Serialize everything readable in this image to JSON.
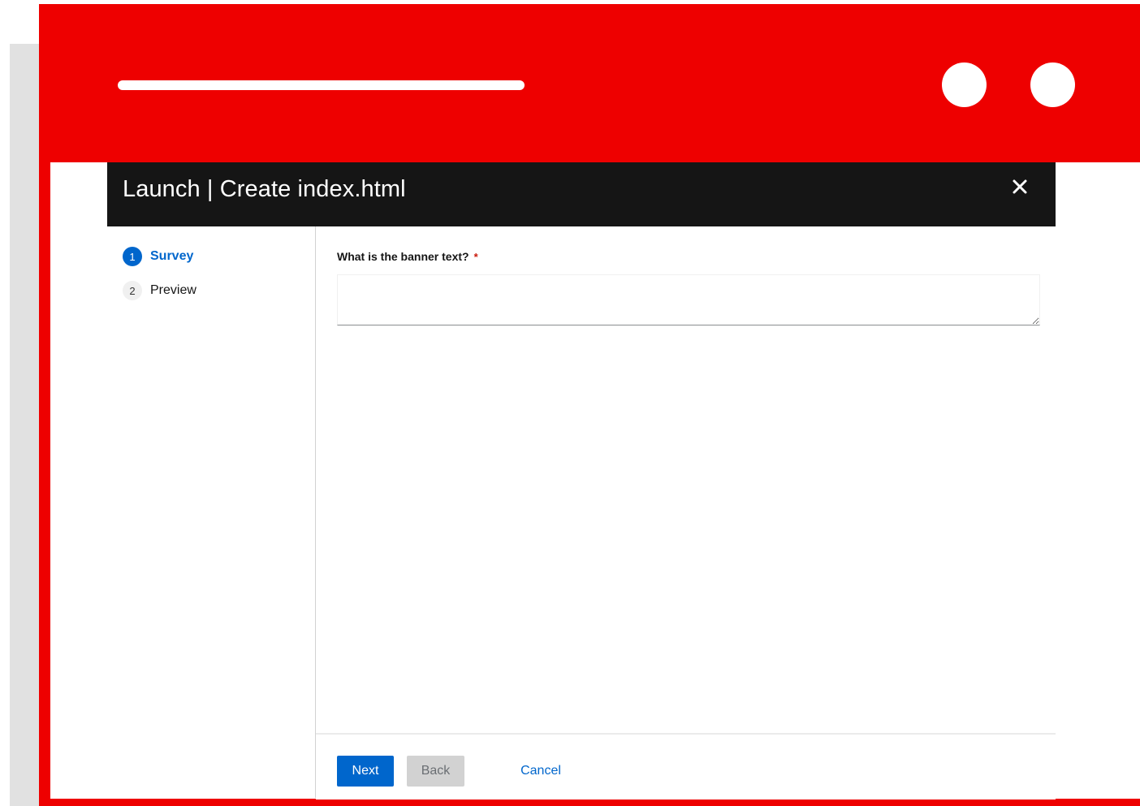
{
  "modal": {
    "title": "Launch | Create index.html",
    "close_icon": "close-icon"
  },
  "wizard_nav": {
    "steps": [
      {
        "number": "1",
        "label": "Survey",
        "state": "active"
      },
      {
        "number": "2",
        "label": "Preview",
        "state": "inactive"
      }
    ]
  },
  "survey": {
    "question": "What is the banner text?",
    "required_marker": "*",
    "answer_value": "",
    "answer_placeholder": ""
  },
  "footer": {
    "next_label": "Next",
    "back_label": "Back",
    "cancel_label": "Cancel"
  },
  "colors": {
    "frame_red": "#ee0000",
    "header_dark": "#151515",
    "accent_blue": "#0066cc",
    "required_red": "#c9190b",
    "disabled_gray": "#d2d2d2"
  }
}
